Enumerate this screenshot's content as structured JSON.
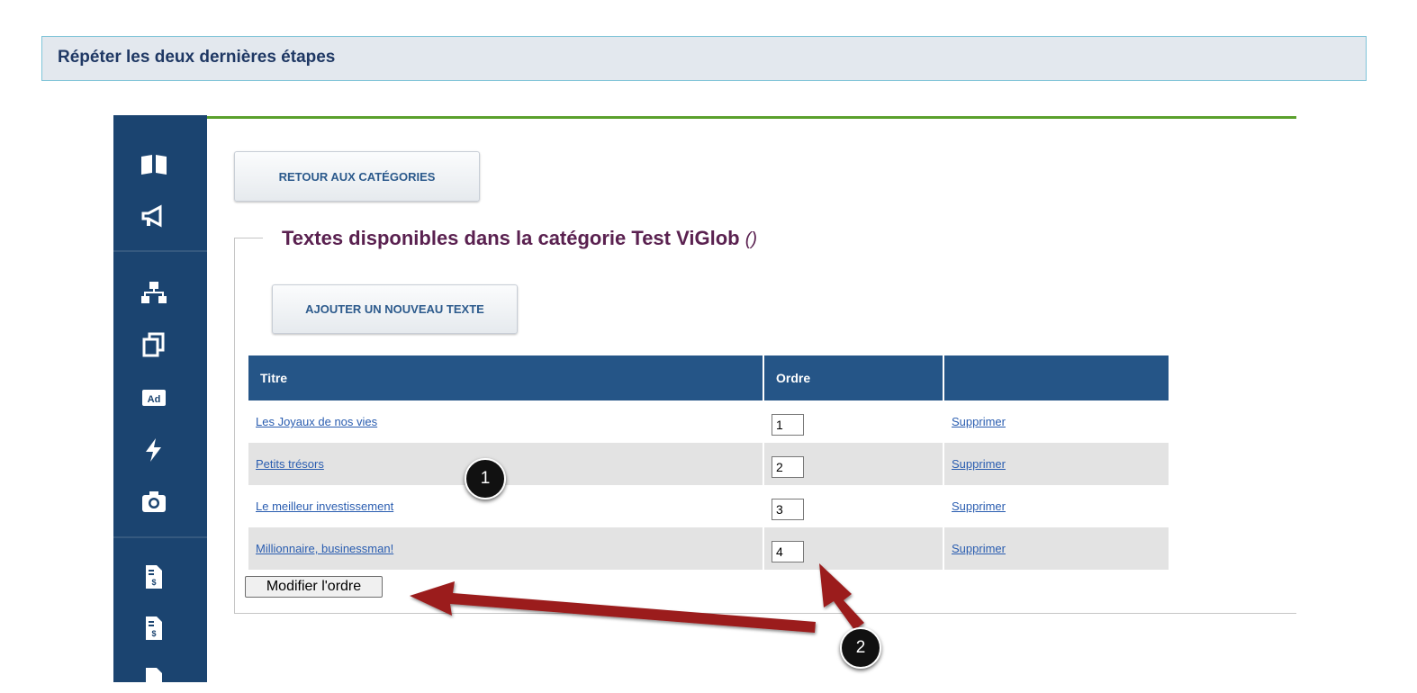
{
  "step": {
    "title": "Répéter les deux dernières étapes"
  },
  "sidebar": {
    "icons": [
      "book-icon",
      "megaphone-icon",
      "sitemap-icon",
      "copy-icon",
      "ad-icon",
      "bolt-icon",
      "camera-icon",
      "invoice-icon",
      "invoice-icon",
      "invoice-icon"
    ],
    "background": "#1b4470"
  },
  "header": {
    "back_label": "RETOUR AUX CATÉGORIES"
  },
  "section": {
    "legend": "Textes disponibles dans la catégorie Test ViGlob",
    "legend_suffix": "()",
    "add_label": "AJOUTER UN NOUVEAU TEXTE"
  },
  "table": {
    "columns": [
      "Titre",
      "Ordre",
      ""
    ],
    "rows": [
      {
        "title": "Les Joyaux de nos vies",
        "order": "1",
        "action": "Supprimer"
      },
      {
        "title": "Petits trésors",
        "order": "2",
        "action": "Supprimer"
      },
      {
        "title": "Le meilleur investissement",
        "order": "3",
        "action": "Supprimer"
      },
      {
        "title": "Millionnaire, businessman!",
        "order": "4",
        "action": "Supprimer"
      }
    ]
  },
  "modify_label": "Modifier l'ordre",
  "callouts": [
    "1",
    "2"
  ],
  "colors": {
    "header": "#255587",
    "accent_line": "#5aa02c",
    "arrow": "#9b1c1c",
    "legend": "#5a2150"
  }
}
